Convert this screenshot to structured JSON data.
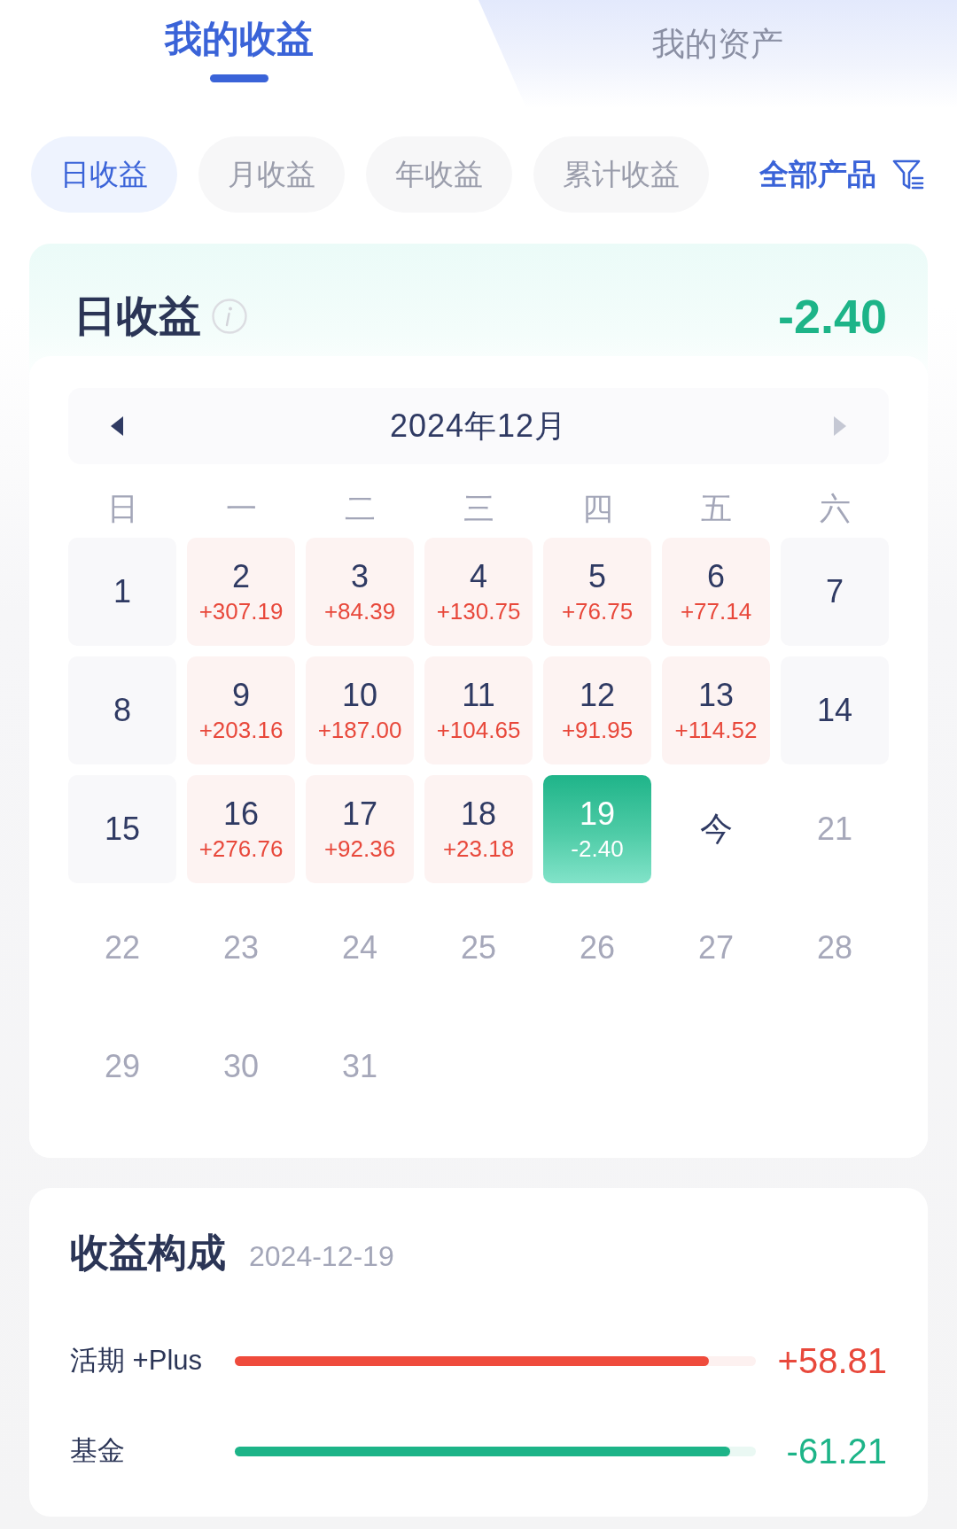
{
  "tabs": [
    {
      "label": "我的收益",
      "selected": true
    },
    {
      "label": "我的资产",
      "selected": false
    }
  ],
  "period_filters": [
    {
      "label": "日收益",
      "selected": true
    },
    {
      "label": "月收益",
      "selected": false
    },
    {
      "label": "年收益",
      "selected": false
    },
    {
      "label": "累计收益",
      "selected": false
    }
  ],
  "product_filter": {
    "label": "全部产品"
  },
  "earnings": {
    "title": "日收益",
    "value": "-2.40",
    "kind": "loss"
  },
  "calendar": {
    "month": "2024年12月",
    "prev_disabled": false,
    "next_disabled": true,
    "weekdays": [
      "日",
      "一",
      "二",
      "三",
      "四",
      "五",
      "六"
    ],
    "days": [
      {
        "label": "1",
        "kind": "plain",
        "selected": false
      },
      {
        "label": "2",
        "amount": "+307.19",
        "kind": "gain",
        "selected": false
      },
      {
        "label": "3",
        "amount": "+84.39",
        "kind": "gain",
        "selected": false
      },
      {
        "label": "4",
        "amount": "+130.75",
        "kind": "gain",
        "selected": false
      },
      {
        "label": "5",
        "amount": "+76.75",
        "kind": "gain",
        "selected": false
      },
      {
        "label": "6",
        "amount": "+77.14",
        "kind": "gain",
        "selected": false
      },
      {
        "label": "7",
        "kind": "plain",
        "selected": false
      },
      {
        "label": "8",
        "kind": "plain",
        "selected": false
      },
      {
        "label": "9",
        "amount": "+203.16",
        "kind": "gain",
        "selected": false
      },
      {
        "label": "10",
        "amount": "+187.00",
        "kind": "gain",
        "selected": false
      },
      {
        "label": "11",
        "amount": "+104.65",
        "kind": "gain",
        "selected": false
      },
      {
        "label": "12",
        "amount": "+91.95",
        "kind": "gain",
        "selected": false
      },
      {
        "label": "13",
        "amount": "+114.52",
        "kind": "gain",
        "selected": false
      },
      {
        "label": "14",
        "kind": "plain",
        "selected": false
      },
      {
        "label": "15",
        "kind": "plain",
        "selected": false
      },
      {
        "label": "16",
        "amount": "+276.76",
        "kind": "gain",
        "selected": false
      },
      {
        "label": "17",
        "amount": "+92.36",
        "kind": "gain",
        "selected": false
      },
      {
        "label": "18",
        "amount": "+23.18",
        "kind": "gain",
        "selected": false
      },
      {
        "label": "19",
        "amount": "-2.40",
        "kind": "loss",
        "selected": true
      },
      {
        "label": "今",
        "kind": "today",
        "selected": false
      },
      {
        "label": "21",
        "kind": "future",
        "selected": false
      },
      {
        "label": "22",
        "kind": "future",
        "selected": false
      },
      {
        "label": "23",
        "kind": "future",
        "selected": false
      },
      {
        "label": "24",
        "kind": "future",
        "selected": false
      },
      {
        "label": "25",
        "kind": "future",
        "selected": false
      },
      {
        "label": "26",
        "kind": "future",
        "selected": false
      },
      {
        "label": "27",
        "kind": "future",
        "selected": false
      },
      {
        "label": "28",
        "kind": "future",
        "selected": false
      },
      {
        "label": "29",
        "kind": "future",
        "selected": false
      },
      {
        "label": "30",
        "kind": "future",
        "selected": false
      },
      {
        "label": "31",
        "kind": "future",
        "selected": false
      }
    ]
  },
  "breakdown": {
    "title": "收益构成",
    "date": "2024-12-19",
    "items": [
      {
        "name": "活期 +Plus",
        "level": 0.91,
        "value": "+58.81",
        "kind": "gain"
      },
      {
        "name": "基金",
        "level": 0.95,
        "value": "-61.21",
        "kind": "loss"
      }
    ]
  }
}
